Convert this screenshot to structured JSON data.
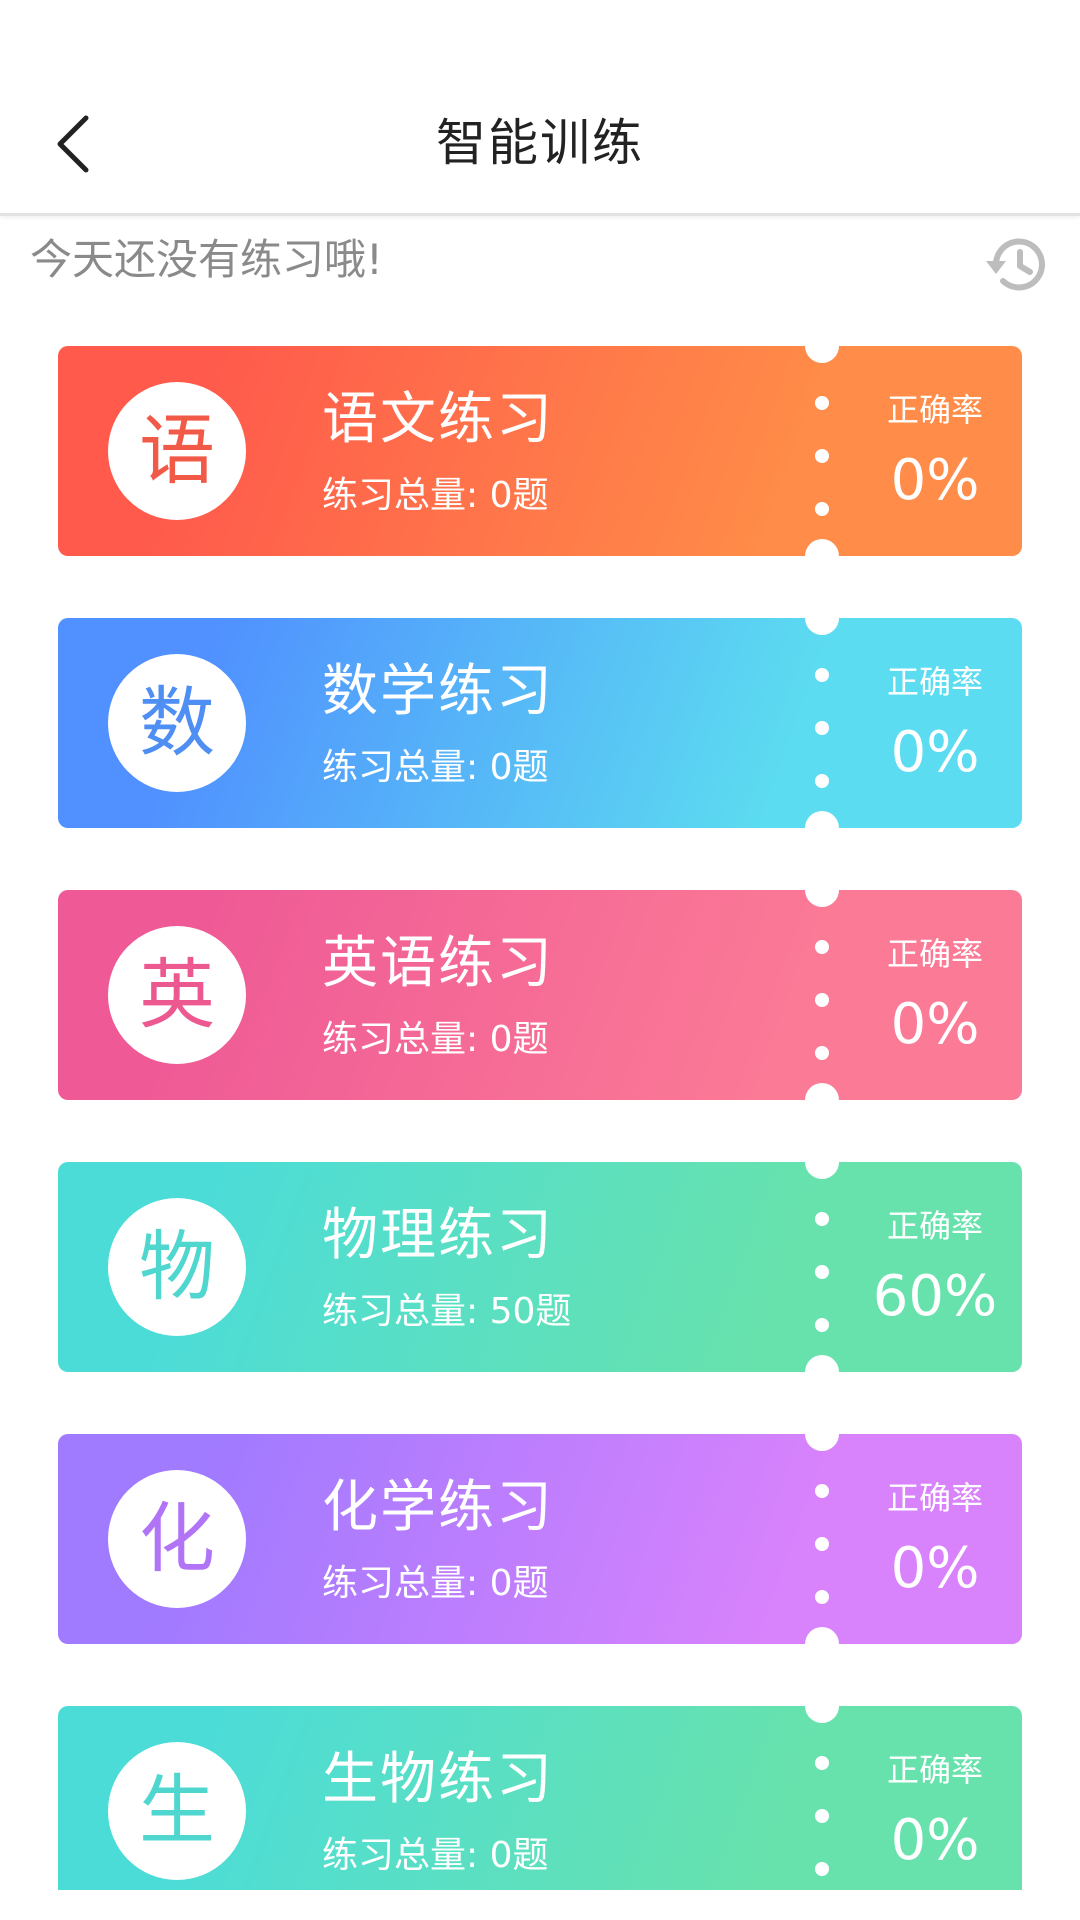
{
  "header": {
    "title": "智能训练",
    "back_icon": "back-chevron-icon"
  },
  "summary": {
    "text": "今天还没有练习哦!",
    "history_icon": "history-clock-icon"
  },
  "subjects": [
    {
      "badge": "语",
      "title": "语文练习",
      "count": "练习总量: 0题",
      "rate_label": "正确率",
      "rate": "0%",
      "gradient": [
        "#ff5a4c",
        "#ff8c48"
      ],
      "badge_color": "#f25a48"
    },
    {
      "badge": "数",
      "title": "数学练习",
      "count": "练习总量: 0题",
      "rate_label": "正确率",
      "rate": "0%",
      "gradient": [
        "#5090ff",
        "#5cdcf0"
      ],
      "badge_color": "#4f8ef2"
    },
    {
      "badge": "英",
      "title": "英语练习",
      "count": "练习总量: 0题",
      "rate_label": "正确率",
      "rate": "0%",
      "gradient": [
        "#ef5a96",
        "#fb7a96"
      ],
      "badge_color": "#ec5990"
    },
    {
      "badge": "物",
      "title": "物理练习",
      "count": "练习总量: 50题",
      "rate_label": "正确率",
      "rate": "60%",
      "gradient": [
        "#4cdcd8",
        "#68e2ac"
      ],
      "badge_color": "#4fd6cf"
    },
    {
      "badge": "化",
      "title": "化学练习",
      "count": "练习总量: 0题",
      "rate_label": "正确率",
      "rate": "0%",
      "gradient": [
        "#a07aff",
        "#d882fc"
      ],
      "badge_color": "#b174f6"
    },
    {
      "badge": "生",
      "title": "生物练习",
      "count": "练习总量: 0题",
      "rate_label": "正确率",
      "rate": "0%",
      "gradient": [
        "#4cdcd8",
        "#68e2ac"
      ],
      "badge_color": "#4fd6cf"
    }
  ]
}
